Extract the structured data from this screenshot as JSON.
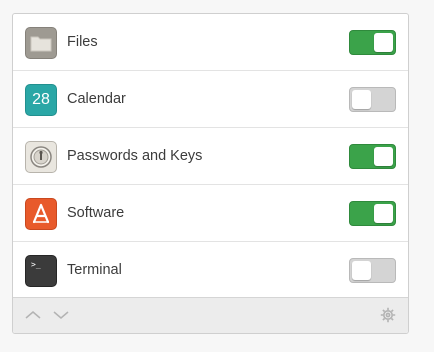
{
  "apps": [
    {
      "name": "Files",
      "icon": "files-folder-icon",
      "enabled": true
    },
    {
      "name": "Calendar",
      "icon": "calendar-icon",
      "icon_text": "28",
      "enabled": false
    },
    {
      "name": "Passwords and Keys",
      "icon": "passwords-keys-icon",
      "enabled": true
    },
    {
      "name": "Software",
      "icon": "software-store-icon",
      "enabled": true
    },
    {
      "name": "Terminal",
      "icon": "terminal-icon",
      "icon_text": ">_",
      "enabled": false
    }
  ],
  "footer": {
    "up_icon": "chevron-up-icon",
    "down_icon": "chevron-down-icon",
    "settings_icon": "gear-icon"
  },
  "colors": {
    "toggle_on": "#3ba34a",
    "toggle_off": "#d4d4d4",
    "calendar": "#2aa7a6",
    "software": "#e85a2b",
    "terminal": "#3b3b3b",
    "files": "#9e9a92"
  }
}
